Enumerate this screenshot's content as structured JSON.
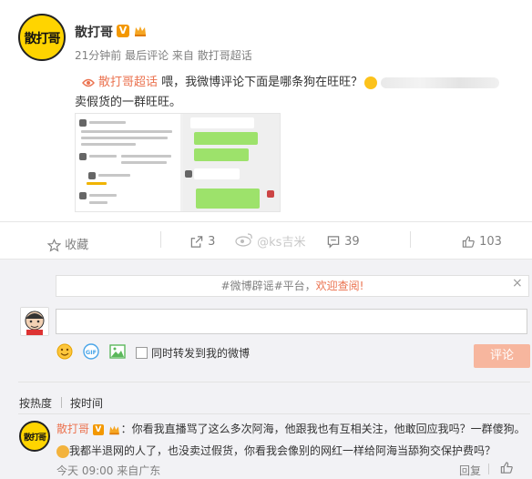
{
  "post": {
    "avatar_text": "散打哥",
    "username": "散打哥",
    "meta": "21分钟前  最后评论  来自 散打哥超话",
    "topic": "散打哥超话",
    "text_line1": "喂，我微博评论下面是哪条狗在旺旺？",
    "text_line2": "卖假货的一群旺旺。"
  },
  "actions": {
    "favorite": "收藏",
    "repost": "3",
    "comment": "39",
    "like": "103",
    "watermark": "@ks吉米"
  },
  "notice": {
    "prefix": "#微博辟谣#平台，",
    "highlight": "欢迎查阅!",
    "close": "×"
  },
  "composer": {
    "also_repost": "同时转发到我的微博",
    "submit": "评论"
  },
  "sort": {
    "hot": "按热度",
    "time": "按时间"
  },
  "comment": {
    "avatar_text": "散打哥",
    "name": "散打哥",
    "line1": "：你看我直播骂了这么多次阿海，他跟我也有互相关注，他敢回应我吗？一群傻狗。",
    "line2": "我都半退网的人了，也没卖过假货，你看我会像别的网红一样给阿海当舔狗交保护费吗？",
    "meta": "今天 09:00 来自广东",
    "reply": "回复"
  },
  "colors": {
    "accent": "#eb7350",
    "meta": "#808080",
    "verified": "#f39800"
  }
}
